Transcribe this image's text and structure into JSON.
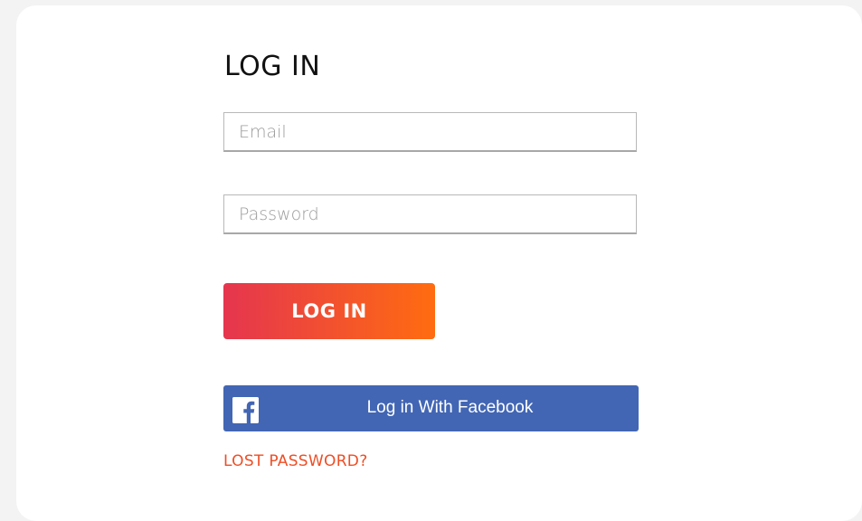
{
  "form": {
    "title": "LOG IN",
    "email_placeholder": "Email",
    "password_placeholder": "Password",
    "submit_label": "LOG IN",
    "facebook_label": "Log in With Facebook",
    "lost_password_label": "LOST PASSWORD?"
  },
  "icons": {
    "facebook": "facebook-f-icon"
  },
  "colors": {
    "background": "#f3f3f4",
    "card": "#ffffff",
    "button_gradient_start": "#e5354f",
    "button_gradient_end": "#ff6c10",
    "facebook_blue": "#4266b4",
    "link_accent": "#ee4e25"
  }
}
